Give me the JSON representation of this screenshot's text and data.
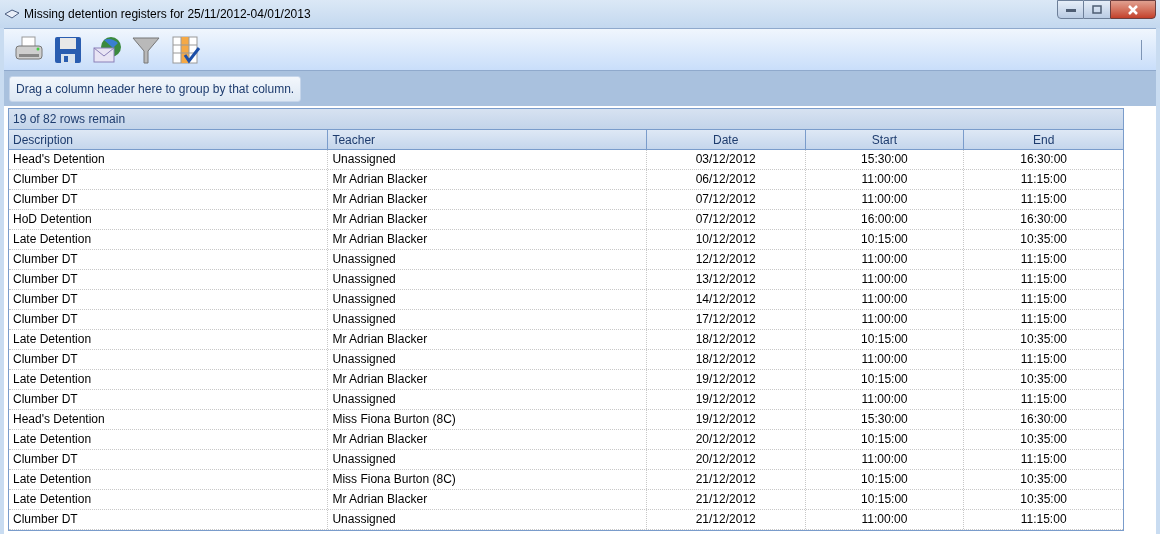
{
  "window": {
    "title": "Missing detention registers for 25/11/2012-04/01/2013"
  },
  "group_panel": {
    "hint": "Drag a column header here to group by that column."
  },
  "grid": {
    "status": "19 of 82 rows remain",
    "columns": [
      {
        "label": "Description"
      },
      {
        "label": "Teacher"
      },
      {
        "label": "Date"
      },
      {
        "label": "Start"
      },
      {
        "label": "End"
      }
    ],
    "rows": [
      [
        "Head's Detention",
        "Unassigned",
        "03/12/2012",
        "15:30:00",
        "16:30:00"
      ],
      [
        "Clumber DT",
        "Mr Adrian Blacker",
        "06/12/2012",
        "11:00:00",
        "11:15:00"
      ],
      [
        "Clumber DT",
        "Mr Adrian Blacker",
        "07/12/2012",
        "11:00:00",
        "11:15:00"
      ],
      [
        "HoD Detention",
        "Mr Adrian Blacker",
        "07/12/2012",
        "16:00:00",
        "16:30:00"
      ],
      [
        "Late Detention",
        "Mr Adrian Blacker",
        "10/12/2012",
        "10:15:00",
        "10:35:00"
      ],
      [
        "Clumber DT",
        "Unassigned",
        "12/12/2012",
        "11:00:00",
        "11:15:00"
      ],
      [
        "Clumber DT",
        "Unassigned",
        "13/12/2012",
        "11:00:00",
        "11:15:00"
      ],
      [
        "Clumber DT",
        "Unassigned",
        "14/12/2012",
        "11:00:00",
        "11:15:00"
      ],
      [
        "Clumber DT",
        "Unassigned",
        "17/12/2012",
        "11:00:00",
        "11:15:00"
      ],
      [
        "Late Detention",
        "Mr Adrian Blacker",
        "18/12/2012",
        "10:15:00",
        "10:35:00"
      ],
      [
        "Clumber DT",
        "Unassigned",
        "18/12/2012",
        "11:00:00",
        "11:15:00"
      ],
      [
        "Late Detention",
        "Mr Adrian Blacker",
        "19/12/2012",
        "10:15:00",
        "10:35:00"
      ],
      [
        "Clumber DT",
        "Unassigned",
        "19/12/2012",
        "11:00:00",
        "11:15:00"
      ],
      [
        "Head's Detention",
        "Miss Fiona Burton (8C)",
        "19/12/2012",
        "15:30:00",
        "16:30:00"
      ],
      [
        "Late Detention",
        "Mr Adrian Blacker",
        "20/12/2012",
        "10:15:00",
        "10:35:00"
      ],
      [
        "Clumber DT",
        "Unassigned",
        "20/12/2012",
        "11:00:00",
        "11:15:00"
      ],
      [
        "Late Detention",
        "Miss Fiona Burton (8C)",
        "21/12/2012",
        "10:15:00",
        "10:35:00"
      ],
      [
        "Late Detention",
        "Mr Adrian Blacker",
        "21/12/2012",
        "10:15:00",
        "10:35:00"
      ],
      [
        "Clumber DT",
        "Unassigned",
        "21/12/2012",
        "11:00:00",
        "11:15:00"
      ]
    ]
  }
}
